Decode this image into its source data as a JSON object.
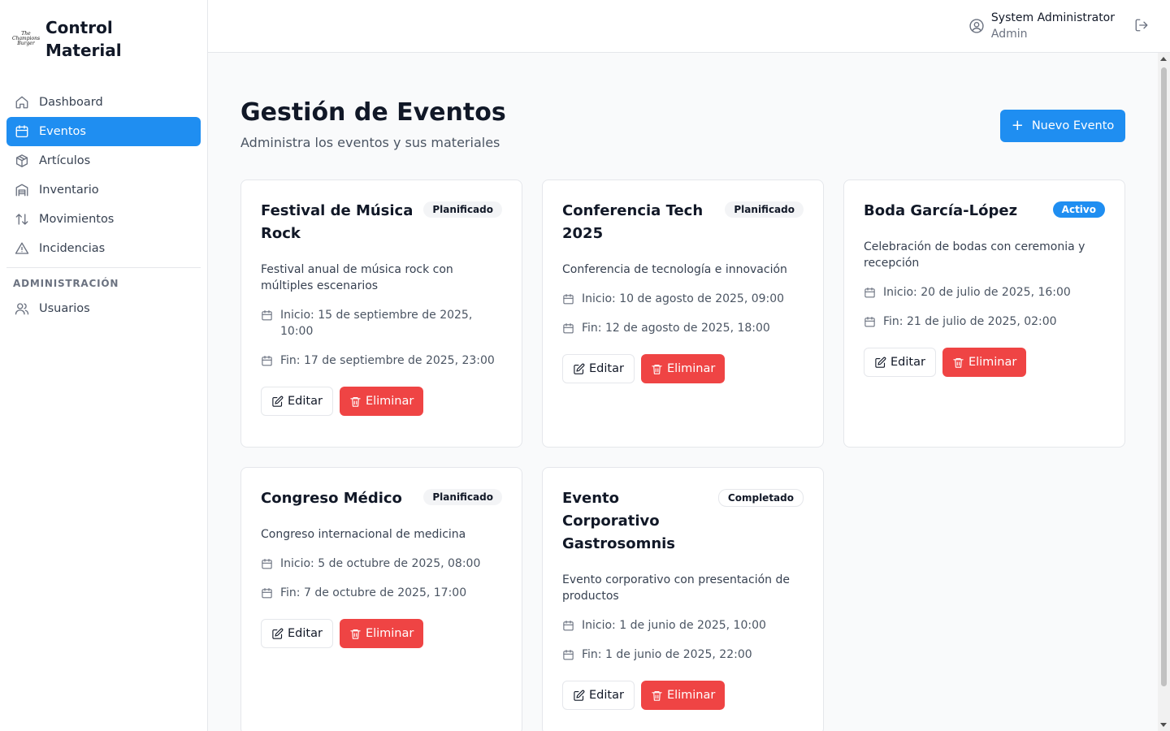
{
  "brand": {
    "title_line1": "Control",
    "title_line2": "Material",
    "logo_text": "The Champions Burger"
  },
  "sidebar": {
    "items": [
      {
        "label": "Dashboard",
        "icon": "home-icon"
      },
      {
        "label": "Eventos",
        "icon": "calendar-icon",
        "active": true
      },
      {
        "label": "Artículos",
        "icon": "box-icon"
      },
      {
        "label": "Inventario",
        "icon": "warehouse-icon"
      },
      {
        "label": "Movimientos",
        "icon": "arrows-up-down-icon"
      },
      {
        "label": "Incidencias",
        "icon": "warning-icon"
      }
    ],
    "section_label": "ADMINISTRACIÓN",
    "admin_items": [
      {
        "label": "Usuarios",
        "icon": "users-icon"
      }
    ]
  },
  "header": {
    "user_name": "System Administrator",
    "user_role": "Admin"
  },
  "page": {
    "title": "Gestión de Eventos",
    "subtitle": "Administra los eventos y sus materiales",
    "new_button": "Nuevo Evento"
  },
  "labels": {
    "edit": "Editar",
    "delete": "Eliminar"
  },
  "events": [
    {
      "title": "Festival de Música Rock",
      "status": "Planificado",
      "description": "Festival anual de música rock con múltiples escenarios",
      "start": "Inicio: 15 de septiembre de 2025, 10:00",
      "end": "Fin: 17 de septiembre de 2025, 23:00"
    },
    {
      "title": "Conferencia Tech 2025",
      "status": "Planificado",
      "description": "Conferencia de tecnología e innovación",
      "start": "Inicio: 10 de agosto de 2025, 09:00",
      "end": "Fin: 12 de agosto de 2025, 18:00"
    },
    {
      "title": "Boda García-López",
      "status": "Activo",
      "description": "Celebración de bodas con ceremonia y recepción",
      "start": "Inicio: 20 de julio de 2025, 16:00",
      "end": "Fin: 21 de julio de 2025, 02:00"
    },
    {
      "title": "Congreso Médico",
      "status": "Planificado",
      "description": "Congreso internacional de medicina",
      "start": "Inicio: 5 de octubre de 2025, 08:00",
      "end": "Fin: 7 de octubre de 2025, 17:00"
    },
    {
      "title": "Evento Corporativo Gastrosomnis",
      "status": "Completado",
      "description": "Evento corporativo con presentación de productos",
      "start": "Inicio: 1 de junio de 2025, 10:00",
      "end": "Fin: 1 de junio de 2025, 22:00"
    }
  ],
  "colors": {
    "primary": "#1f8ef1",
    "danger": "#ef4444",
    "border": "#e5e7eb"
  }
}
